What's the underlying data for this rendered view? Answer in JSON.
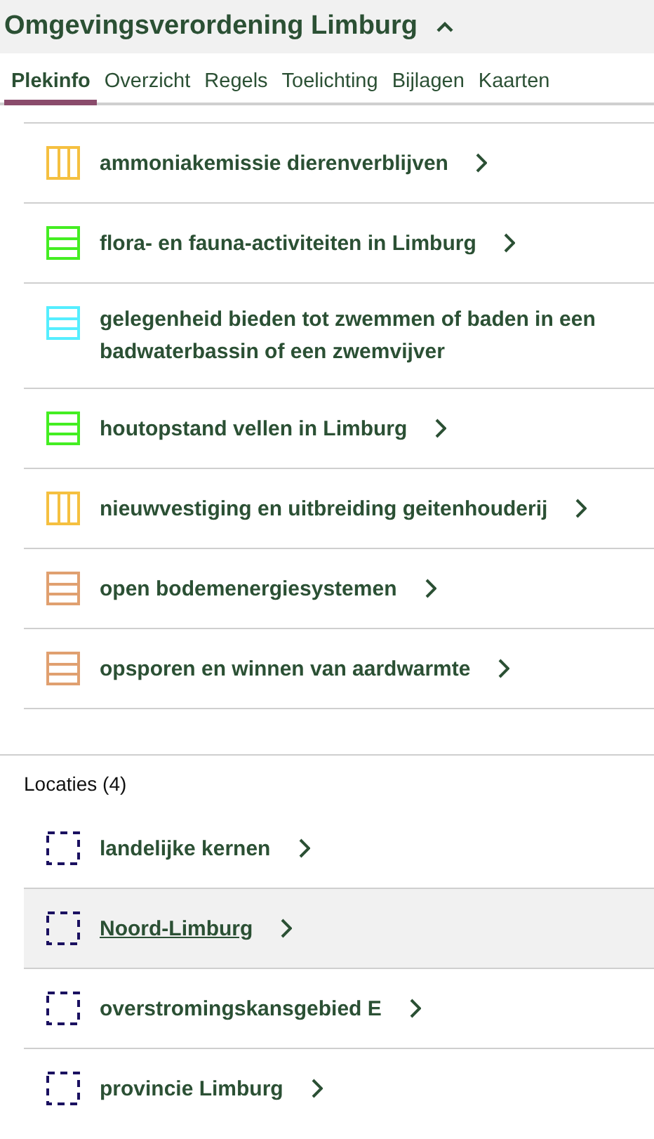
{
  "header": {
    "title": "Omgevingsverordening Limburg",
    "expanded": true
  },
  "tabs": [
    {
      "label": "Plekinfo",
      "selected": true
    },
    {
      "label": "Overzicht",
      "selected": false
    },
    {
      "label": "Regels",
      "selected": false
    },
    {
      "label": "Toelichting",
      "selected": false
    },
    {
      "label": "Bijlagen",
      "selected": false
    },
    {
      "label": "Kaarten",
      "selected": false
    }
  ],
  "activities": [
    {
      "label": "ammoniakemissie dierenverblijven",
      "kind": "vertical",
      "color": "#f5c040",
      "chevron": true
    },
    {
      "label": "flora- en fauna-activiteiten in Limburg",
      "kind": "horizontal",
      "color": "#44ee22",
      "chevron": true
    },
    {
      "label": "gelegenheid bieden tot zwemmen of baden in een badwaterbassin of een zwemvijver",
      "kind": "horizontal",
      "color": "#55eeff",
      "chevron": false
    },
    {
      "label": "houtopstand vellen in Limburg",
      "kind": "horizontal",
      "color": "#44ee22",
      "chevron": true
    },
    {
      "label": "nieuwvestiging en uitbreiding geitenhouderij",
      "kind": "vertical",
      "color": "#f5c040",
      "chevron": true
    },
    {
      "label": "open bodemenergiesystemen",
      "kind": "horizontal",
      "color": "#e0a070",
      "chevron": true
    },
    {
      "label": "opsporen en winnen van aardwarmte",
      "kind": "horizontal",
      "color": "#e0a070",
      "chevron": true
    }
  ],
  "locations": {
    "heading": "Locaties (4)",
    "items": [
      {
        "label": "landelijke kernen",
        "selected": false
      },
      {
        "label": "Noord-Limburg",
        "selected": true
      },
      {
        "label": "overstromingskansgebied E",
        "selected": false
      },
      {
        "label": "provincie Limburg",
        "selected": false
      }
    ]
  }
}
